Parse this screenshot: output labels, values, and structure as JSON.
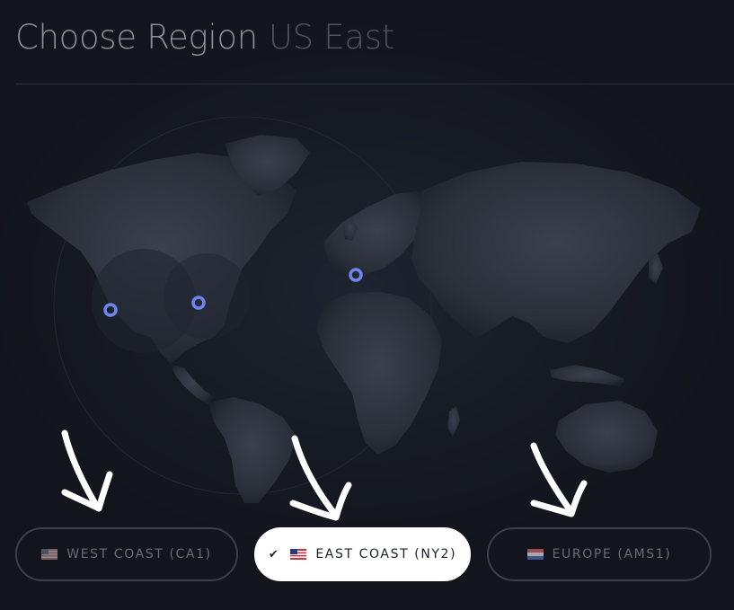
{
  "header": {
    "title": "Choose Region",
    "selected_region": "US East"
  },
  "map": {
    "marker_color": "#6f85f0",
    "markers": [
      "West Coast",
      "East Coast",
      "Europe"
    ]
  },
  "regions": [
    {
      "label": "WEST COAST (CA1)",
      "flag": "us-flag-icon",
      "selected": false
    },
    {
      "label": "EAST COAST (NY2)",
      "flag": "us-flag-icon",
      "selected": true,
      "check": "✔"
    },
    {
      "label": "EUROPE (AMS1)",
      "flag": "nl-flag-icon",
      "selected": false
    }
  ],
  "colors": {
    "background": "#141820",
    "title": "#8a8f98",
    "subtitle": "#4d535d",
    "button_border": "#3a3f49",
    "active_button": "#ffffff",
    "arrows": "#ffffff"
  }
}
